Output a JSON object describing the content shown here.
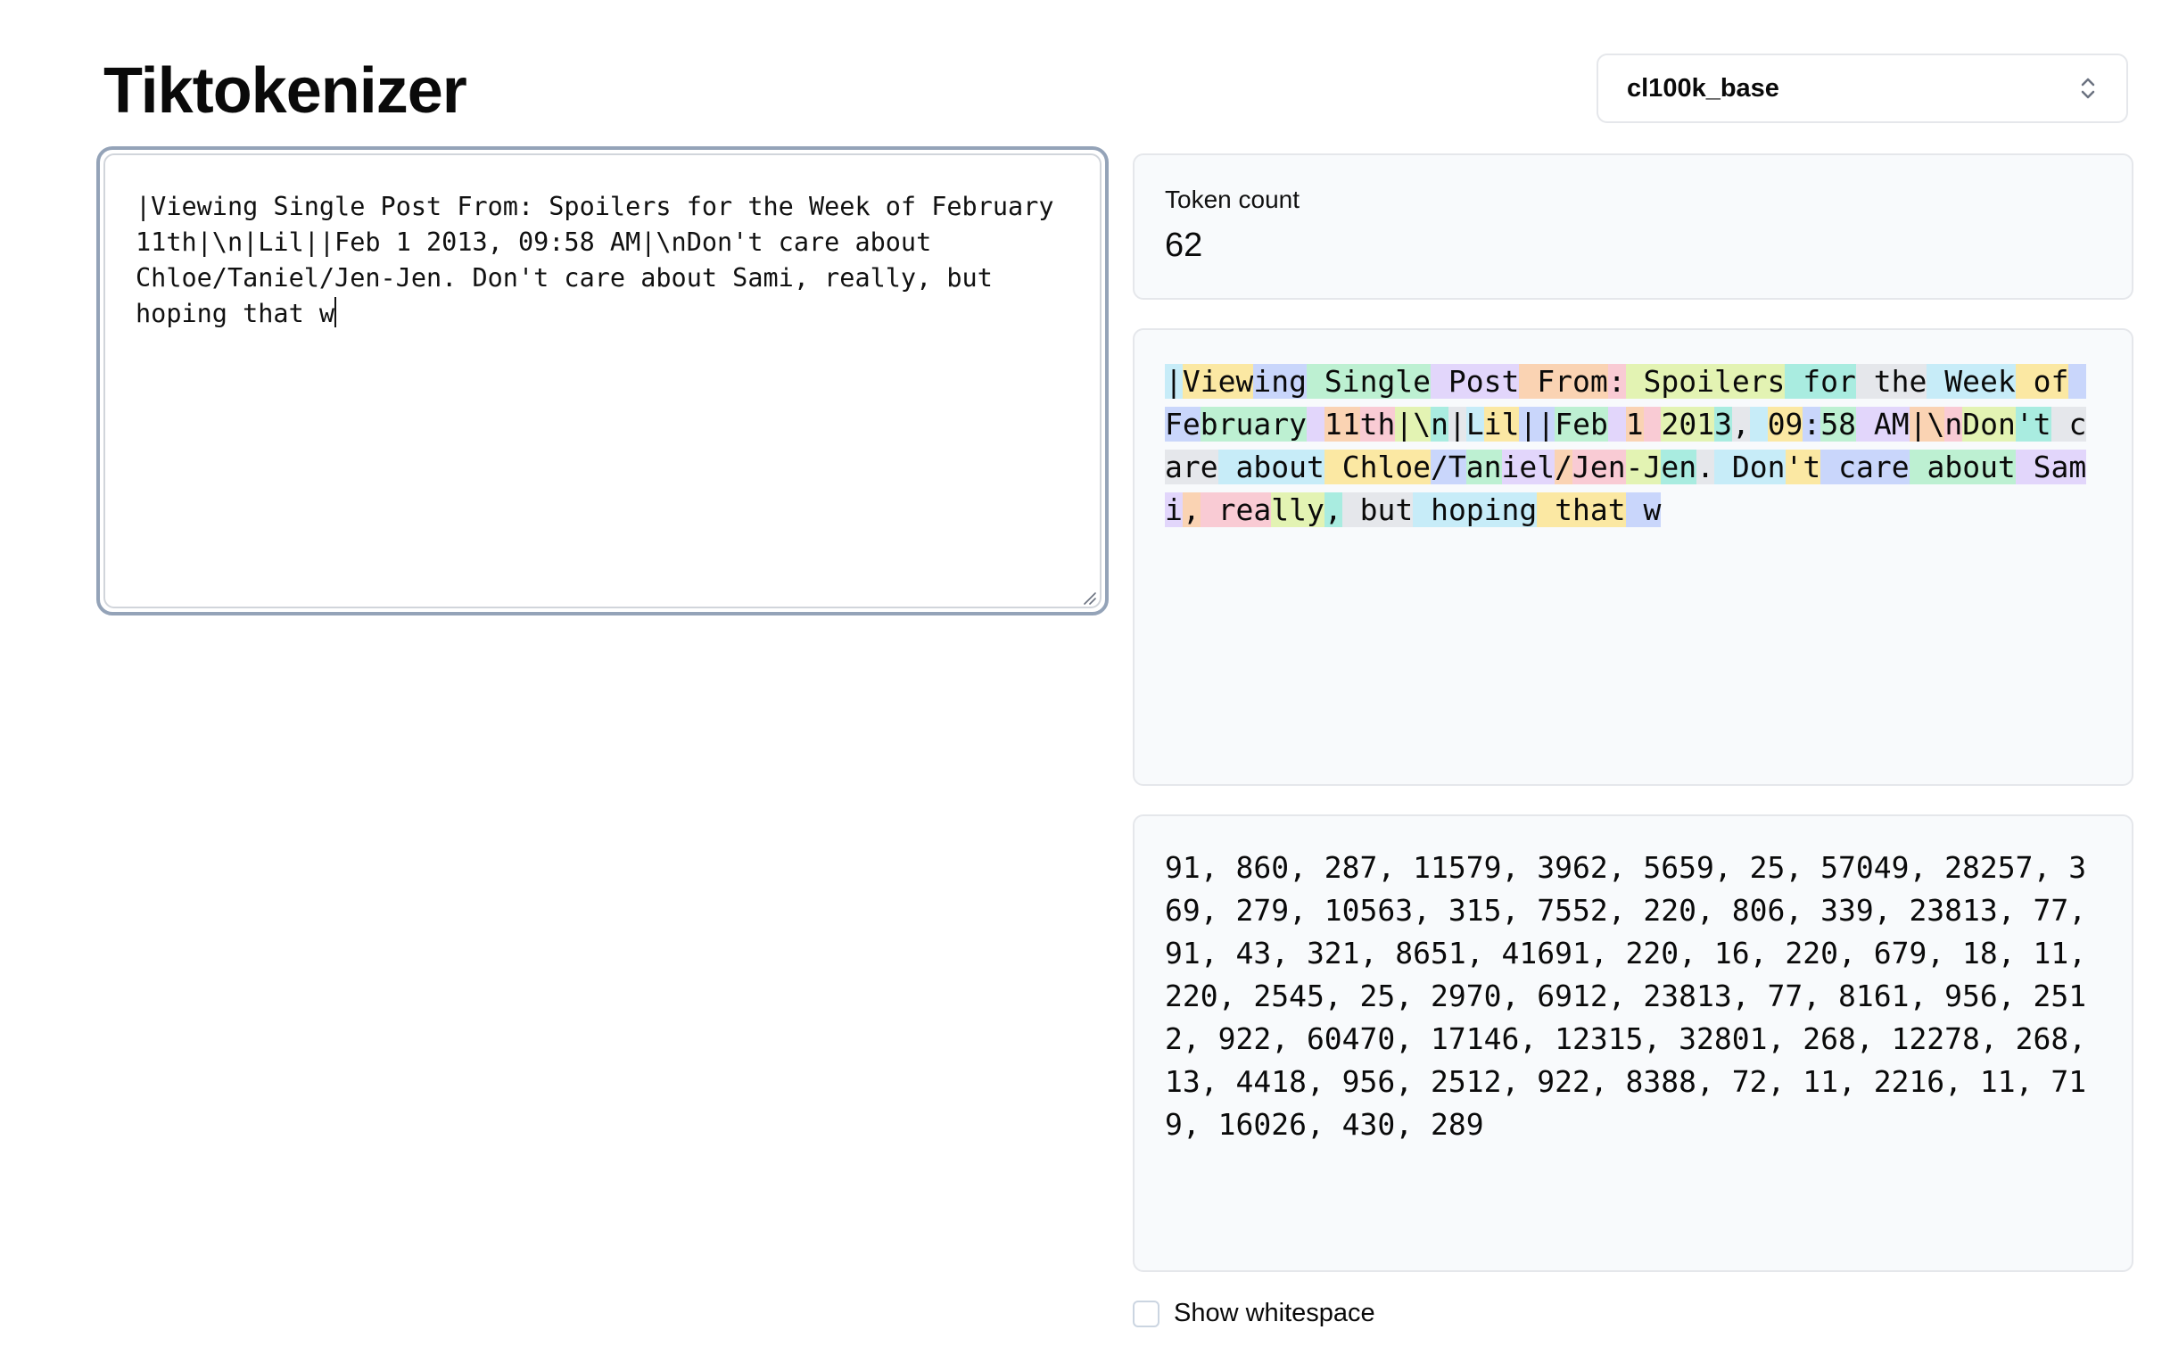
{
  "app": {
    "title": "Tiktokenizer"
  },
  "encoder": {
    "selected": "cl100k_base",
    "icon": "chevron-up-down-icon"
  },
  "input": {
    "value": "|Viewing Single Post From: Spoilers for the Week of February 11th|\\n|Lil||Feb 1 2013, 09:58 AM|\\nDon't care about Chloe/Taniel/Jen-Jen. Don't care about Sami, really, but hoping that w"
  },
  "stats": {
    "label": "Token count",
    "value": "62"
  },
  "token_palette": [
    "#c7ecf8",
    "#fbe8a3",
    "#c9d6fb",
    "#bdf0d2",
    "#e2d6fb",
    "#fad3b3",
    "#f9cbd4",
    "#e3f3b3",
    "#a9ece0",
    "#e5e7eb"
  ],
  "tokens": [
    "|",
    "View",
    "ing",
    " Single",
    " Post",
    " From",
    ":",
    " Spoilers",
    " for",
    " the",
    " Week",
    " of",
    " Fe",
    "bruary",
    " ",
    "11",
    "th",
    "|\\",
    "n",
    "|",
    "L",
    "il",
    "||",
    "Feb",
    " ",
    "1",
    " ",
    "201",
    "3",
    ",",
    " ",
    "09",
    ":",
    "58",
    " AM",
    "|\\",
    "n",
    "Don",
    "'t",
    " care",
    " about",
    " Chloe",
    "/T",
    "an",
    "iel",
    "/",
    "Jen",
    "-J",
    "en",
    ".",
    " Don",
    "'t",
    " care",
    " about",
    " Sami",
    ",",
    " rea",
    "lly",
    ",",
    " but",
    " hoping",
    " that",
    " w"
  ],
  "token_ids_text": "91, 860, 287, 11579, 3962, 5659, 25, 57049, 28257, 369, 279, 10563, 315, 7552, 220, 806, 339, 23813, 77, 91, 43, 321, 8651, 41691, 220, 16, 220, 679, 18, 11, 220, 2545, 25, 2970, 6912, 23813, 77, 8161, 956, 2512, 922, 60470, 17146, 12315, 32801, 268, 12278, 268, 13, 4418, 956, 2512, 922, 8388, 72, 11, 2216, 11, 719, 16026, 430, 289",
  "options": {
    "show_whitespace_label": "Show whitespace",
    "show_whitespace_checked": false
  }
}
